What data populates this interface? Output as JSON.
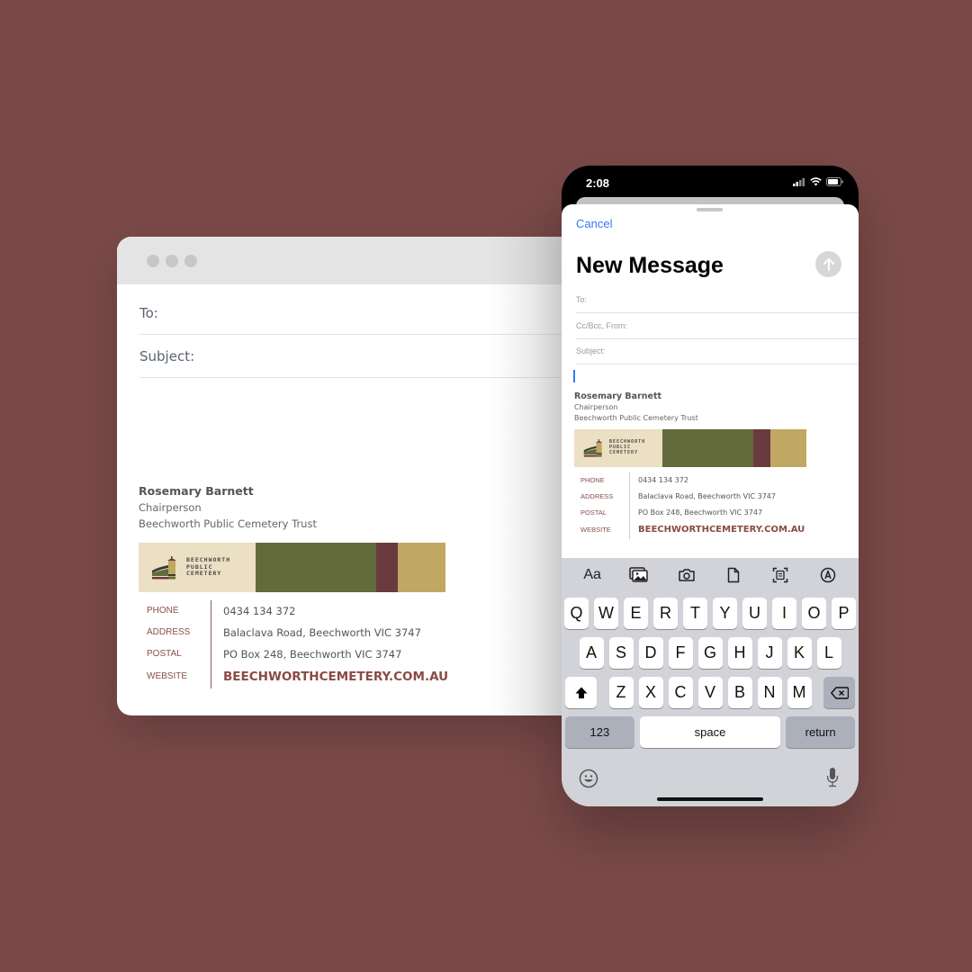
{
  "colors": {
    "background": "#7a4a49",
    "accent_blue": "#3478f6",
    "brand_olive": "#636a3b",
    "brand_wine": "#6a3b3e",
    "brand_gold": "#c0a862",
    "brand_cream": "#ebdfc4",
    "link_brown": "#8a4a44"
  },
  "desktop": {
    "window_controls": [
      "window-dot",
      "window-dot",
      "window-dot"
    ],
    "to_label": "To:",
    "subject_label": "Subject:"
  },
  "signature": {
    "name": "Rosemary Barnett",
    "title": "Chairperson",
    "organization": "Beechworth Public Cemetery Trust",
    "logo_lines": [
      "BEECHWORTH",
      "PUBLIC",
      "CEMETERY"
    ],
    "contacts": [
      {
        "label": "PHONE",
        "value": "0434 134 372"
      },
      {
        "label": "ADDRESS",
        "value": "Balaclava Road, Beechworth VIC 3747"
      },
      {
        "label": "POSTAL",
        "value": "PO Box 248, Beechworth VIC 3747"
      },
      {
        "label": "WEBSITE",
        "value": "BEECHWORTHCEMETERY.COM.AU"
      }
    ]
  },
  "phone": {
    "status_time": "2:08",
    "status_icons": [
      "signal-icon",
      "wifi-icon",
      "battery-icon"
    ],
    "cancel_label": "Cancel",
    "title": "New Message",
    "send_icon": "arrow-up-icon",
    "fields": {
      "to": "To:",
      "cc_bcc_from": "Cc/Bcc, From:",
      "subject": "Subject:"
    },
    "keyboard": {
      "toolbar": {
        "format_label": "Aa",
        "icons": [
          "photo-library-icon",
          "camera-icon",
          "document-icon",
          "scan-document-icon",
          "markup-icon"
        ]
      },
      "row1": [
        "Q",
        "W",
        "E",
        "R",
        "T",
        "Y",
        "U",
        "I",
        "O",
        "P"
      ],
      "row2": [
        "A",
        "S",
        "D",
        "F",
        "G",
        "H",
        "J",
        "K",
        "L"
      ],
      "row3": [
        "Z",
        "X",
        "C",
        "V",
        "B",
        "N",
        "M"
      ],
      "numbers_label": "123",
      "space_label": "space",
      "return_label": "return"
    }
  }
}
